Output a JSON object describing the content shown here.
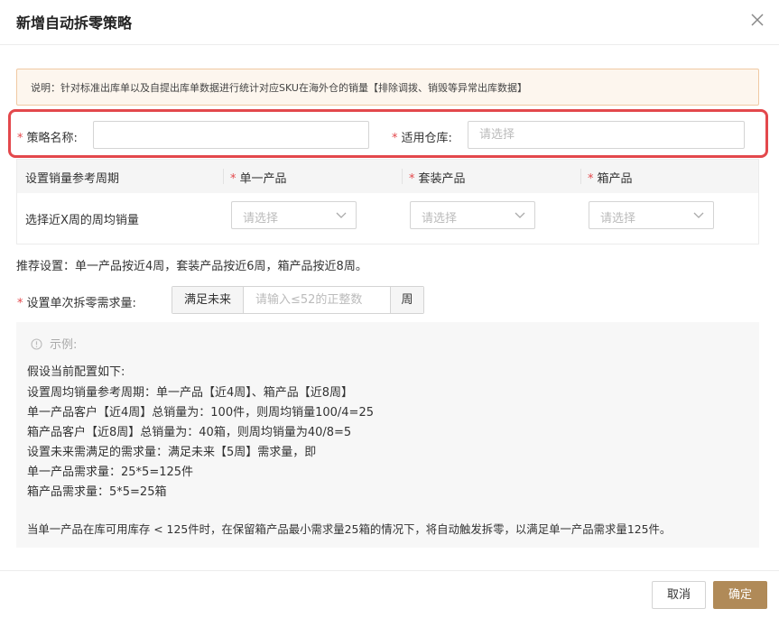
{
  "dialog": {
    "title": "新增自动拆零策略"
  },
  "notice": {
    "text": "说明：针对标准出库单以及自提出库单数据进行统计对应SKU在海外仓的销量【排除调拨、销毁等异常出库数据】"
  },
  "form": {
    "required_mark": "*",
    "strategy_name_label": "策略名称:",
    "strategy_name_value": "",
    "warehouse_label": "适用仓库:",
    "warehouse_placeholder": "请选择"
  },
  "period_table": {
    "headers": [
      "设置销量参考周期",
      "单一产品",
      "套装产品",
      "箱产品"
    ],
    "row_label": "选择近X周的周均销量",
    "select_placeholder": "请选择"
  },
  "recommend": "推荐设置：单一产品按近4周，套装产品按近6周，箱产品按近8周。",
  "demand": {
    "label": "设置单次拆零需求量:",
    "prefix": "满足未来",
    "placeholder": "请输入≤52的正整数",
    "suffix": "周"
  },
  "example": {
    "title": "示例:",
    "lines": [
      "假设当前配置如下:",
      "设置周均销量参考周期：单一产品【近4周】、箱产品【近8周】",
      "单一产品客户【近4周】总销量为：100件，则周均销量100/4=25",
      "箱产品客户【近8周】总销量为：40箱，则周均销量为40/8=5",
      "设置未来需满足的需求量：满足未来【5周】需求量，即",
      "单一产品需求量：25*5=125件",
      "箱产品需求量：5*5=25箱"
    ],
    "conclusion": "当单一产品在库可用库存 < 125件时，在保留箱产品最小需求量25箱的情况下，将自动触发拆零，以满足单一产品需求量125件。"
  },
  "footer": {
    "cancel_label": "取消",
    "confirm_label": "确定"
  },
  "colors": {
    "primary": "#b08a58",
    "required": "#e3484c",
    "notice_bg": "#fdf6ee",
    "notice_border": "#f0c9a3",
    "highlight_border": "#e3484c"
  },
  "icons": {
    "close": "close-icon",
    "dropdown": "chevron-down-icon",
    "info": "info-circle-icon"
  }
}
